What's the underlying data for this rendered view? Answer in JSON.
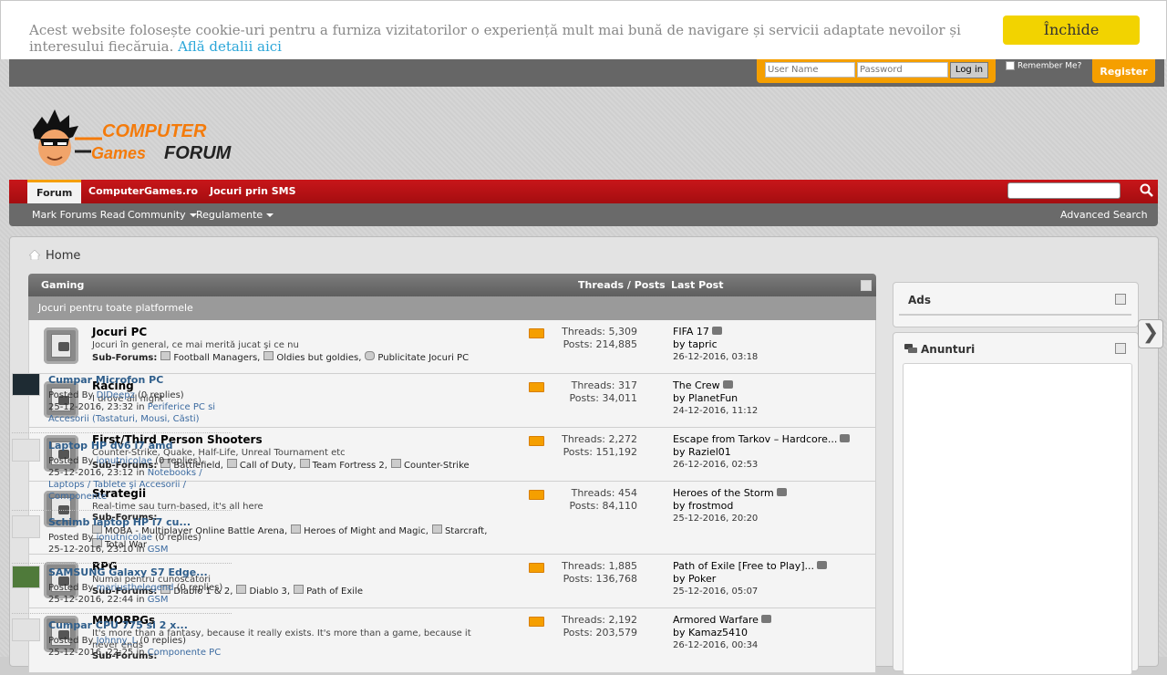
{
  "cookie": {
    "message": "Acest website folosește cookie-uri pentru a furniza vizitatorilor o experiență mult mai bună de navigare și servicii adaptate nevoilor și interesului fiecăruia.",
    "link": "Află detalii aici",
    "close": "Închide"
  },
  "login": {
    "username_placeholder": "User Name",
    "password_placeholder": "Password",
    "login_button": "Log in",
    "remember": "Remember Me?",
    "register": "Register"
  },
  "nav": {
    "tabs": [
      "Forum",
      "ComputerGames.ro",
      "Jocuri prin SMS"
    ],
    "sub": [
      "Mark Forums Read",
      "Community",
      "Regulamente"
    ],
    "advanced_search": "Advanced Search"
  },
  "breadcrumb": {
    "home": "Home"
  },
  "forum": {
    "header": {
      "title": "Gaming",
      "threads_posts": "Threads / Posts",
      "last_post": "Last Post"
    },
    "description": "Jocuri pentru toate platformele",
    "rows": [
      {
        "title": "Jocuri PC",
        "desc": "Jocuri în general, ce mai merită jucat şi ce nu",
        "subs_label": "Sub-Forums:",
        "subs": [
          "Football Managers",
          "Oldies but goldies",
          "Publicitate Jocuri PC"
        ],
        "threads": "Threads: 5,309",
        "posts": "Posts: 214,885",
        "last_title": "FIFA 17",
        "last_by": "by",
        "last_user": "tapric",
        "last_date": "26-12-2016, 03:18"
      },
      {
        "title": "Racing",
        "desc": "I drove all night",
        "subs_label": "",
        "subs": [],
        "threads": "Threads: 317",
        "posts": "Posts: 34,011",
        "last_title": "The Crew",
        "last_by": "by",
        "last_user": "PlanetFun",
        "last_date": "24-12-2016, 11:12"
      },
      {
        "title": "First/Third Person Shooters",
        "desc": "Counter-Strike, Quake, Half-Life, Unreal Tournament etc",
        "subs_label": "Sub-Forums:",
        "subs": [
          "Battlefield",
          "Call of Duty",
          "Team Fortress 2",
          "Counter-Strike"
        ],
        "threads": "Threads: 2,272",
        "posts": "Posts: 151,192",
        "last_title": "Escape from Tarkov – Hardcore...",
        "last_by": "by",
        "last_user": "Raziel01",
        "last_date": "26-12-2016, 02:53"
      },
      {
        "title": "Strategii",
        "desc": "Real-time sau turn-based, it's all here",
        "subs_label": "Sub-Forums:",
        "subs": [
          "MOBA - Multiplayer Online Battle Arena",
          "Heroes of Might and Magic",
          "Starcraft",
          "Total War"
        ],
        "threads": "Threads: 454",
        "posts": "Posts: 84,110",
        "last_title": "Heroes of the Storm",
        "last_by": "by",
        "last_user": "frostmod",
        "last_date": "25-12-2016, 20:20"
      },
      {
        "title": "RPG",
        "desc": "Numai pentru cunoscători",
        "subs_label": "Sub-Forums:",
        "subs": [
          "Diablo 1 & 2",
          "Diablo 3",
          "Path of Exile"
        ],
        "threads": "Threads: 1,885",
        "posts": "Posts: 136,768",
        "last_title": "Path of Exile [Free to Play]...",
        "last_by": "by",
        "last_user": "Poker",
        "last_date": "25-12-2016, 05:07"
      },
      {
        "title": "MMORPGs",
        "desc": "It's more than a fantasy, because it really exists. It's more than a game, because it never ends",
        "subs_label": "Sub-Forums:",
        "subs": [],
        "threads": "Threads: 2,192",
        "posts": "Posts: 203,579",
        "last_title": "Armored Warfare",
        "last_by": "by",
        "last_user": "Kamaz5410",
        "last_date": "26-12-2016, 00:34"
      }
    ]
  },
  "sidebar": {
    "ads_title": "Ads",
    "announcements_title": "Anunturi",
    "items": [
      {
        "title": "Cumpar Microfon PC",
        "posted_by": "Posted By",
        "user": "DJDeepz",
        "replies": "(0 replies)",
        "date": "25-12-2016, 23:32 in",
        "category": "Periferice PC si Accesorii (Tastaturi, Mousi, Căsti)"
      },
      {
        "title": "Laptop HP dv6 i7 amd",
        "posted_by": "Posted By",
        "user": "ionutnicolae",
        "replies": "(0 replies)",
        "date": "25-12-2016, 23:12 in",
        "category": "Notebooks / Laptops / Tablete şi Accesorii / Componente"
      },
      {
        "title": "Schimb laptop HP i7 cu...",
        "posted_by": "Posted By",
        "user": "ionutnicolae",
        "replies": "(0 replies)",
        "date": "25-12-2016, 23:10 in",
        "category": "GSM"
      },
      {
        "title": "SAMSUNG Galaxy S7 Edge...",
        "posted_by": "Posted By",
        "user": "mariusthelegend",
        "replies": "(0 replies)",
        "date": "25-12-2016, 22:44 in",
        "category": "GSM"
      },
      {
        "title": "Cumpar CPU 775 si 2 x...",
        "posted_by": "Posted By",
        "user": "Johnny_L",
        "replies": "(0 replies)",
        "date": "25-12-2016, 22:25 in",
        "category": "Componente PC"
      }
    ]
  },
  "colors": {
    "accent": "#f59f00",
    "nav_red": "#b81114",
    "cookie_button": "#f2d300",
    "link": "#2f5e8b"
  }
}
